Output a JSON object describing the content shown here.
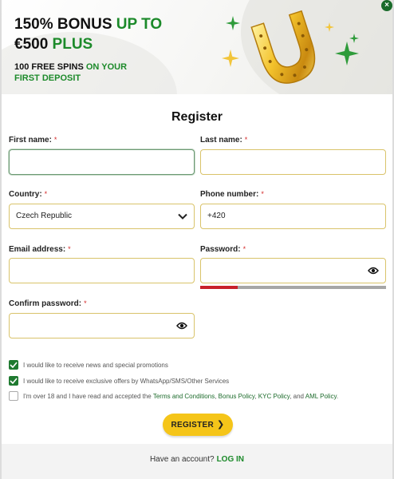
{
  "banner": {
    "headline_part1": "150% BONUS ",
    "headline_part2": "UP TO",
    "headline_part3": "€500 ",
    "headline_part4": "PLUS",
    "sub_part1": "100 FREE SPINS ",
    "sub_part2": "ON YOUR",
    "sub_part3": "FIRST DEPOSIT"
  },
  "close_glyph": "×",
  "form": {
    "title": "Register",
    "required_mark": "*",
    "first_name": {
      "label": "First name:",
      "value": ""
    },
    "last_name": {
      "label": "Last name:",
      "value": ""
    },
    "country": {
      "label": "Country:",
      "value": "Czech Republic"
    },
    "phone": {
      "label": "Phone number:",
      "value": "+420"
    },
    "email": {
      "label": "Email address:",
      "value": ""
    },
    "password": {
      "label": "Password:",
      "value": "",
      "strength": 0.2
    },
    "confirm_password": {
      "label": "Confirm password:",
      "value": ""
    }
  },
  "checkboxes": [
    {
      "text": "I would like to receive news and special promotions",
      "checked": true
    },
    {
      "text": "I would like to receive exclusive offers by WhatsApp/SMS/Other Services",
      "checked": true
    },
    {
      "text_before": "I'm over 18 and I have read and accepted the ",
      "link1": "Terms and Conditions",
      "sep1": ", ",
      "link2": "Bonus Policy",
      "sep2": ", ",
      "link3": "KYC Policy",
      "sep3": ", and ",
      "link4": "AML Policy",
      "text_after": ".",
      "checked": false
    }
  ],
  "register_button": {
    "label": "REGISTER",
    "arrow": "❯"
  },
  "footer": {
    "question": "Have an account?",
    "login": "LOG IN"
  },
  "colors": {
    "brand_green": "#1c8a2a",
    "button_yellow": "#f5c519",
    "input_border": "#d9c36a",
    "required_red": "#d42a2a",
    "strength_red": "#c8202a"
  }
}
